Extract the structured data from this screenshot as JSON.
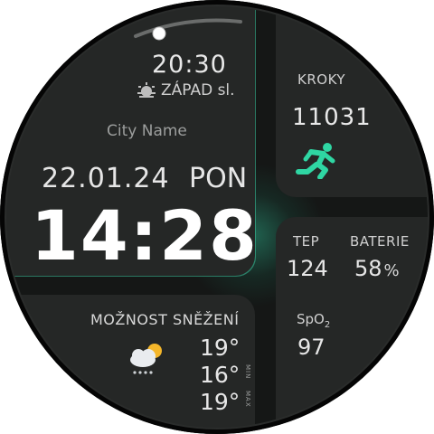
{
  "top": {
    "time": "20:30",
    "sun_label": "ZÁPAD sl.",
    "city": "City Name",
    "date": "22.01.24",
    "weekday": "PON",
    "clock": "14:28"
  },
  "steps": {
    "label": "KROKY",
    "value": "11031",
    "icon": "runner-icon"
  },
  "stats": {
    "heart_label": "TEP",
    "heart_value": "124",
    "battery_label": "BATERIE",
    "battery_value": "58",
    "battery_unit": "%",
    "spo2_label_main": "SpO",
    "spo2_label_sub": "2",
    "spo2_value": "97"
  },
  "weather": {
    "title": "MOŽNOST SNĚŽENÍ",
    "icon": "snow-cloud-sun-icon",
    "current": "19°",
    "min": "16°",
    "max": "19°",
    "min_label": "MIN",
    "max_label": "MAX"
  },
  "colors": {
    "accent": "#2fd6a3",
    "background": "#151716",
    "panel": "#252726"
  }
}
